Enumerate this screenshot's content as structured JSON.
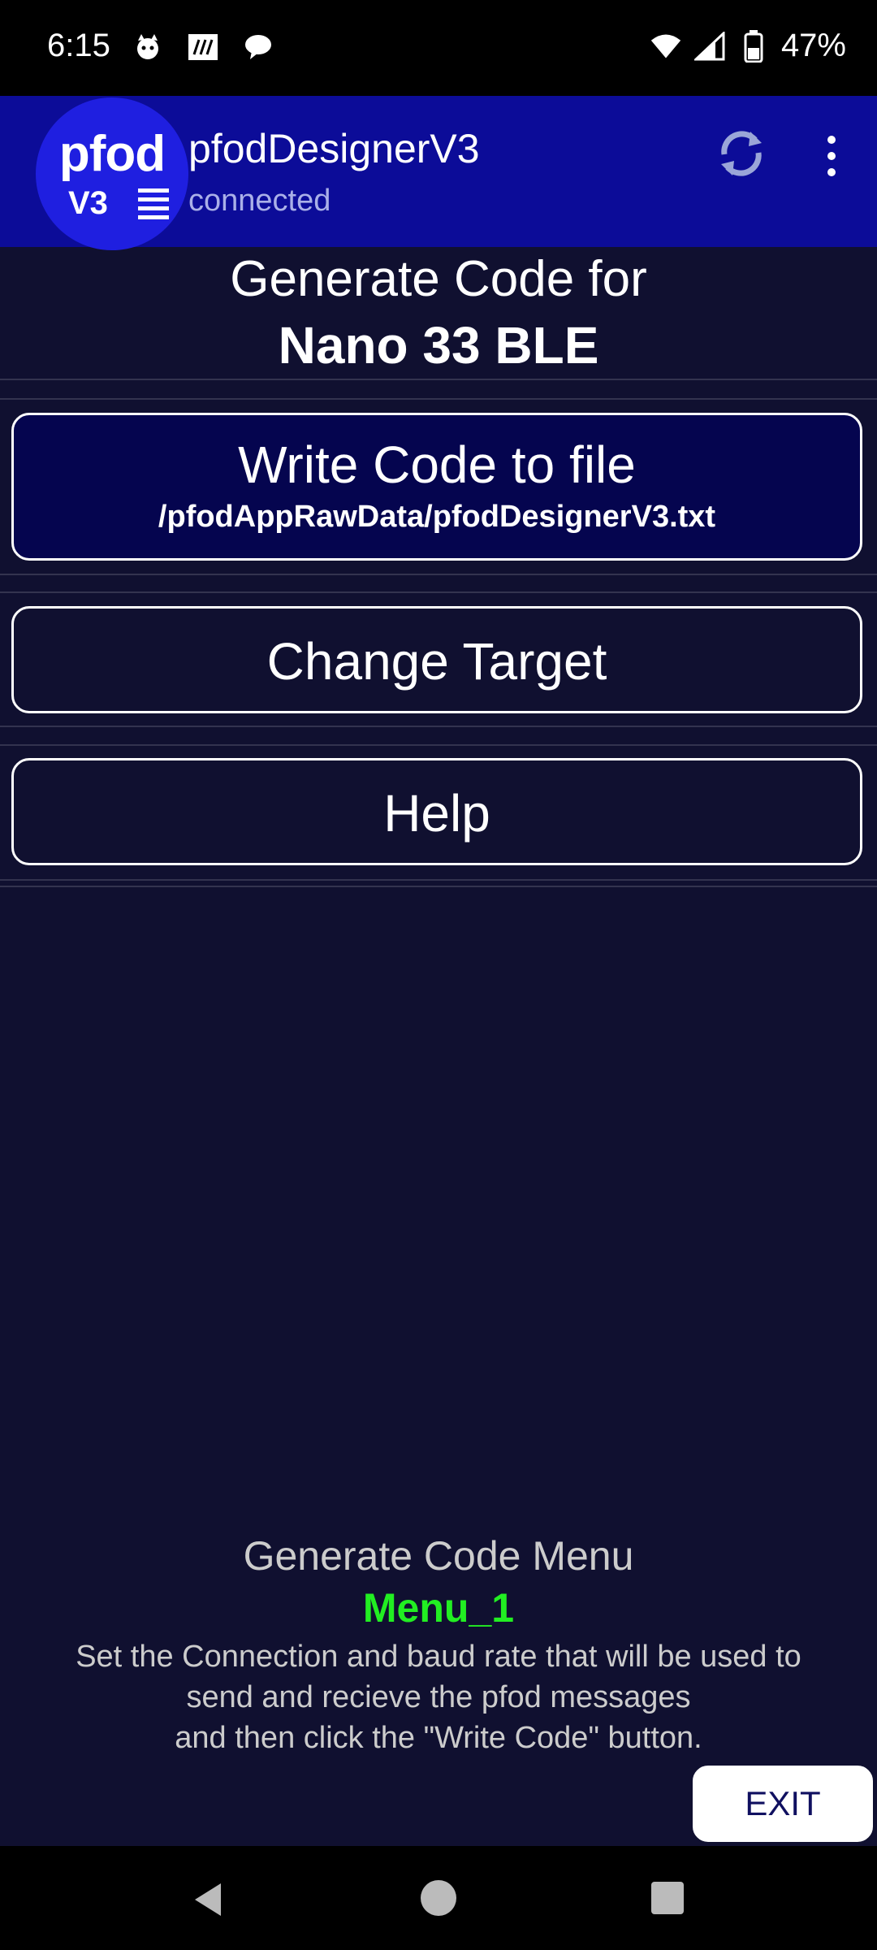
{
  "status_bar": {
    "time": "6:15",
    "battery": "47%",
    "icons_left": [
      "cat-icon",
      "notes-icon",
      "chat-icon"
    ],
    "icons_right": [
      "wifi-icon",
      "signal-icon",
      "battery-icon"
    ]
  },
  "app_bar": {
    "logo_text": "pfod",
    "logo_sub": "V3",
    "title": "pfodDesignerV3",
    "subtitle": "connected",
    "color": "#0c0c98"
  },
  "header": {
    "line1": "Generate Code for",
    "line2": "Nano 33 BLE"
  },
  "buttons": {
    "write_code": {
      "label": "Write Code to file",
      "path": "/pfodAppRawData/pfodDesignerV3.txt"
    },
    "change_target": {
      "label": "Change Target"
    },
    "help": {
      "label": "Help"
    },
    "exit": {
      "label": "EXIT"
    }
  },
  "footer": {
    "title": "Generate Code Menu",
    "menu_id": "Menu_1",
    "desc_line1": "Set the Connection and baud rate that will be used to",
    "desc_line2": "send and recieve the pfod messages",
    "desc_line3": "and then click the \"Write Code\" button.",
    "menu_id_color": "#22ee22"
  },
  "theme": {
    "background": "#101030",
    "button_highlight": "#05054f"
  }
}
